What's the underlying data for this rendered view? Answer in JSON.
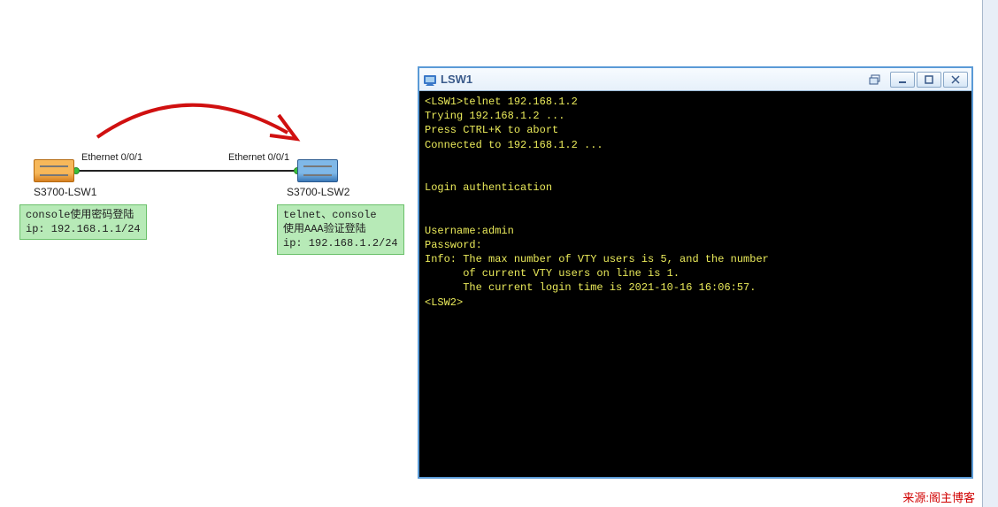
{
  "topology": {
    "switch1": {
      "name": "S3700-LSW1",
      "port": "Ethernet 0/0/1"
    },
    "switch2": {
      "name": "S3700-LSW2",
      "port": "Ethernet 0/0/1"
    },
    "note1": "console使用密码登陆\nip: 192.168.1.1/24",
    "note2": "telnet、console\n使用AAA验证登陆\nip: 192.168.1.2/24"
  },
  "terminal": {
    "title": "LSW1",
    "lines": [
      "<LSW1>telnet 192.168.1.2",
      "Trying 192.168.1.2 ...",
      "Press CTRL+K to abort",
      "Connected to 192.168.1.2 ...",
      "",
      "",
      "Login authentication",
      "",
      "",
      "Username:admin",
      "Password:",
      "Info: The max number of VTY users is 5, and the number",
      "      of current VTY users on line is 1.",
      "      The current login time is 2021-10-16 16:06:57.",
      "<LSW2>"
    ]
  },
  "watermark": "来源:阁主博客"
}
